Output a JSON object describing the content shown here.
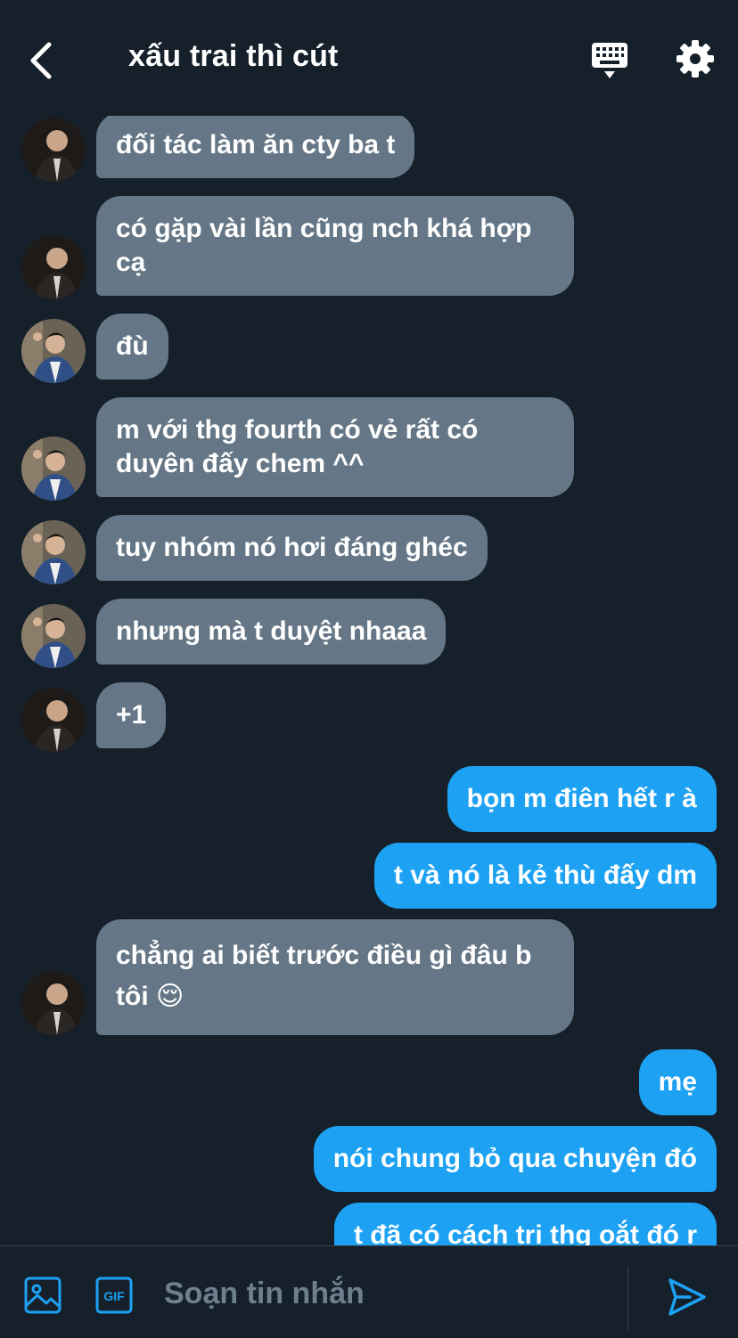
{
  "header": {
    "title": "xấu trai thì cút",
    "back_icon": "back-arrow-icon",
    "keyboard_icon": "keyboard-icon",
    "settings_icon": "gear-icon"
  },
  "messages": [
    {
      "side": "in",
      "avatar": "avatar-1",
      "text": "đối tác làm ăn cty ba t"
    },
    {
      "side": "in",
      "avatar": "avatar-1",
      "text": "có gặp vài lần cũng nch khá hợp cạ"
    },
    {
      "side": "in",
      "avatar": "avatar-2",
      "text": "đù"
    },
    {
      "side": "in",
      "avatar": "avatar-2",
      "text": "m với thg fourth có vẻ rất có duyên đấy chem ^^"
    },
    {
      "side": "in",
      "avatar": "avatar-2",
      "text": "tuy nhóm nó hơi đáng ghéc"
    },
    {
      "side": "in",
      "avatar": "avatar-2",
      "text": "nhưng mà t duyệt nhaaa"
    },
    {
      "side": "in",
      "avatar": "avatar-1",
      "text": "+1"
    },
    {
      "side": "out",
      "text": "bọn m điên hết r à"
    },
    {
      "side": "out",
      "text": "t và nó là kẻ thù đấy dm"
    },
    {
      "side": "in",
      "avatar": "avatar-1",
      "text": "chẳng ai biết trước điều gì đâu b tôi 😌"
    },
    {
      "side": "out",
      "text": "mẹ"
    },
    {
      "side": "out",
      "text": "nói chung bỏ qua chuyện đó"
    },
    {
      "side": "out",
      "text": "t đã có cách trị thg oắt đó r"
    }
  ],
  "composer": {
    "placeholder": "Soạn tin nhắn",
    "image_icon": "image-icon",
    "gif_label": "GIF",
    "send_icon": "send-icon"
  },
  "colors": {
    "background": "#15202b",
    "incoming_bubble": "#657786",
    "outgoing_bubble": "#1da1f2",
    "accent": "#1da1f2"
  }
}
